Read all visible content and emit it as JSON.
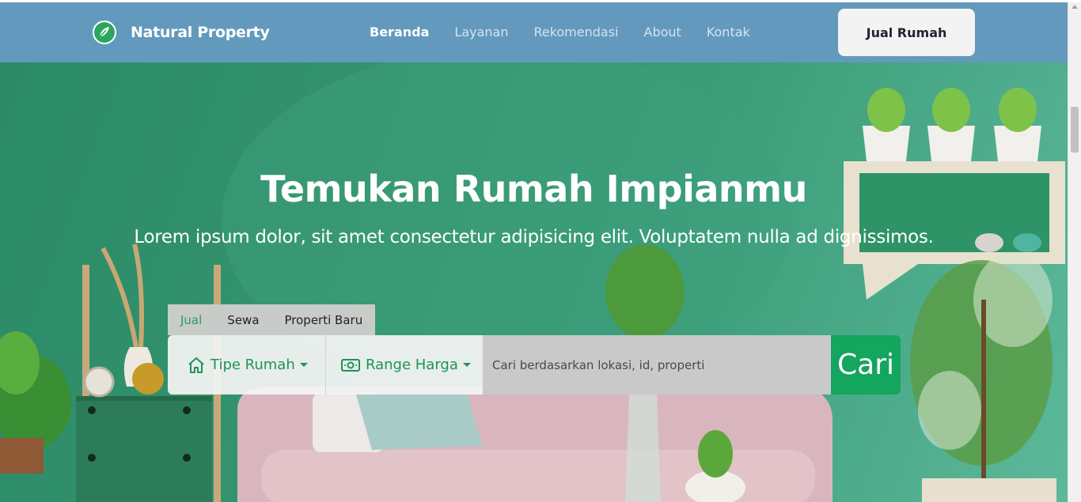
{
  "navbar": {
    "brand": "Natural Property",
    "links": [
      {
        "label": "Beranda",
        "active": true
      },
      {
        "label": "Layanan",
        "active": false
      },
      {
        "label": "Rekomendasi",
        "active": false
      },
      {
        "label": "About",
        "active": false
      },
      {
        "label": "Kontak",
        "active": false
      }
    ],
    "cta_label": "Jual Rumah"
  },
  "hero": {
    "title": "Temukan Rumah Impianmu",
    "subtitle": "Lorem ipsum dolor, sit amet consectetur adipisicing elit. Voluptatem nulla ad dignissimos."
  },
  "search": {
    "tabs": [
      {
        "label": "Jual",
        "active": true
      },
      {
        "label": "Sewa",
        "active": false
      },
      {
        "label": "Properti Baru",
        "active": false
      }
    ],
    "house_type_label": "Tipe Rumah",
    "price_range_label": "Range Harga",
    "placeholder": "Cari berdasarkan lokasi, id, properti",
    "button_label": "Cari"
  },
  "colors": {
    "navbar": "#6399bd",
    "accent": "#14a55e",
    "hero_green": "#35946f"
  },
  "icons": {
    "brand": "leaf-logo-icon",
    "house_type": "house-icon",
    "price": "money-icon"
  }
}
